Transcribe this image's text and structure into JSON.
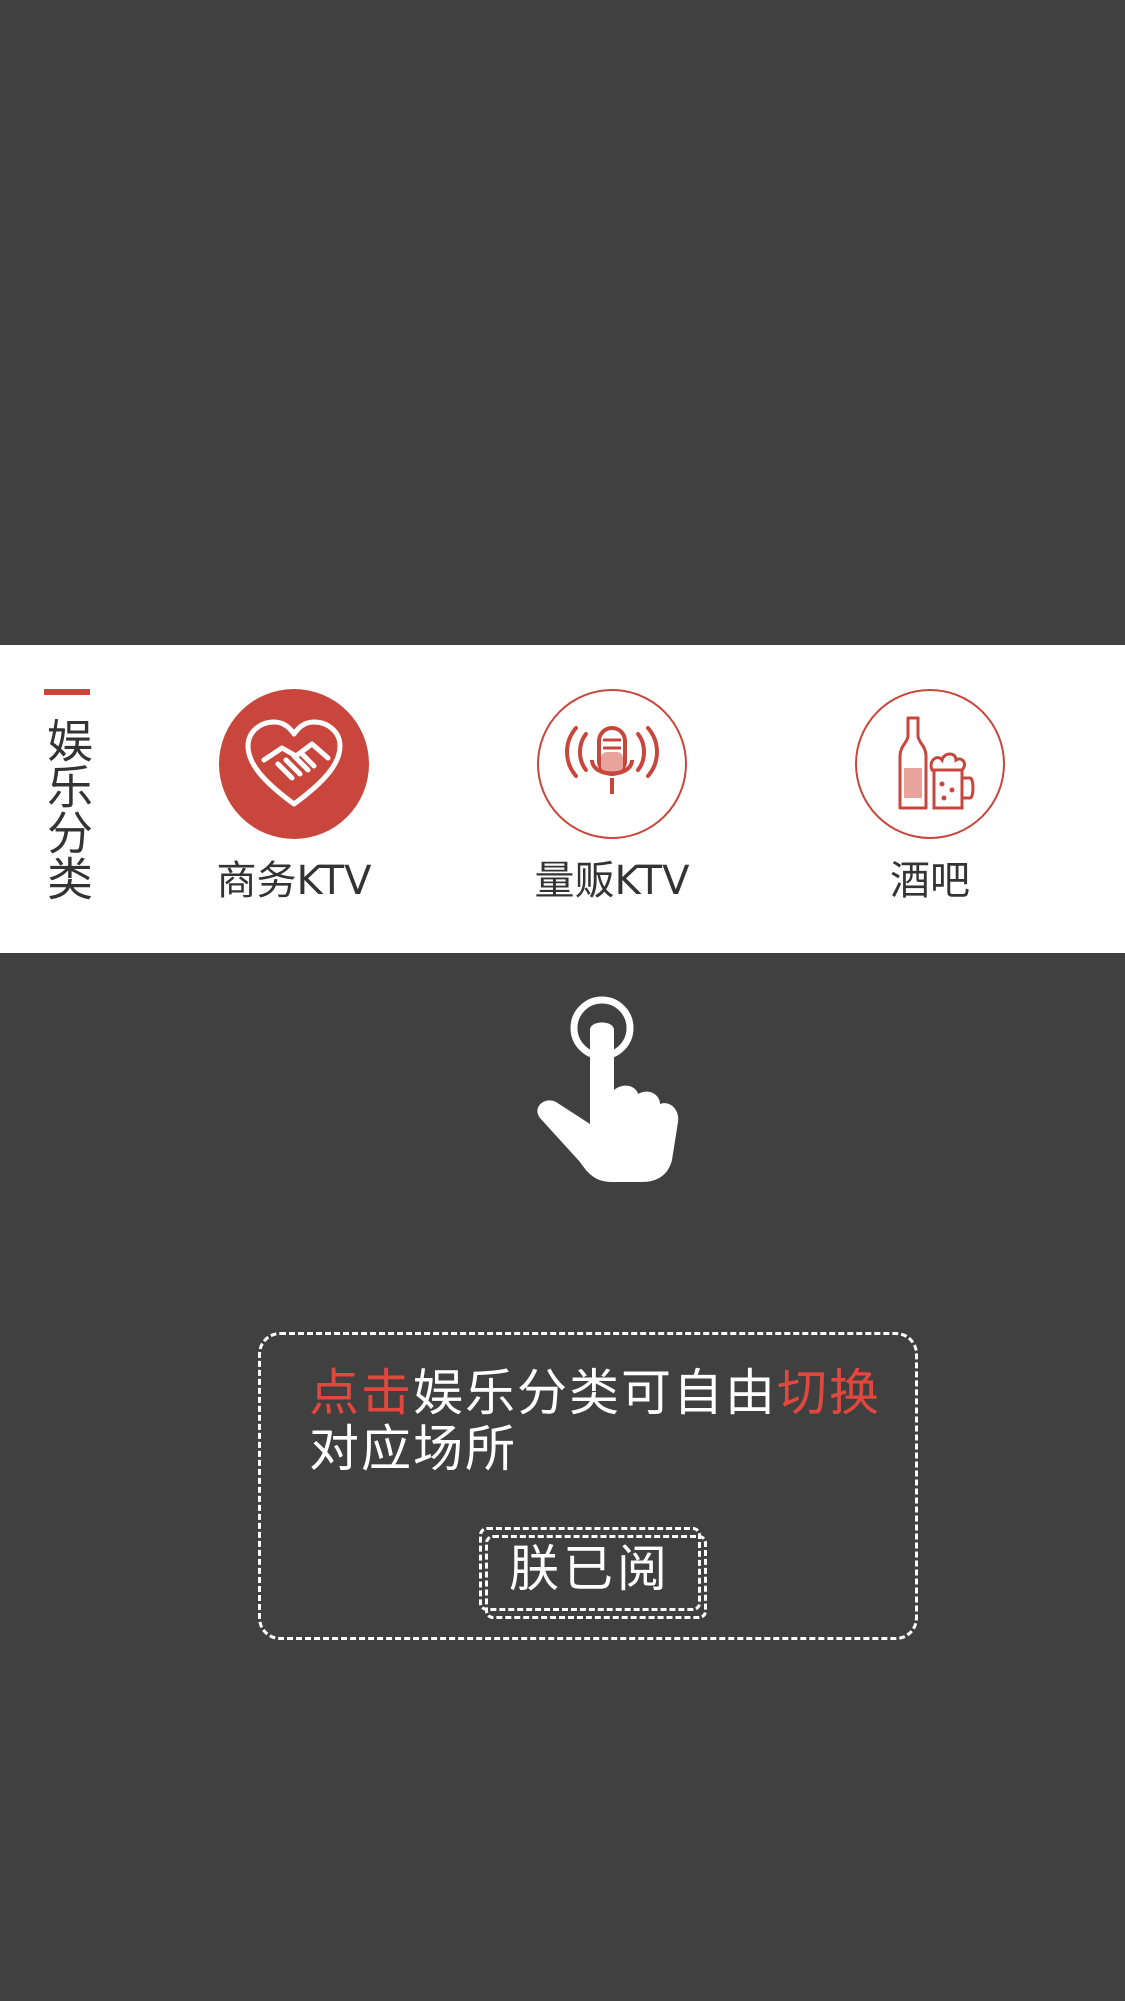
{
  "category_bar": {
    "heading": "娱乐分类",
    "items": [
      {
        "label": "商务KTV",
        "icon": "handshake-heart-icon",
        "active": true
      },
      {
        "label": "量贩KTV",
        "icon": "microphone-icon",
        "active": false
      },
      {
        "label": "酒吧",
        "icon": "wine-beer-icon",
        "active": false
      }
    ]
  },
  "hint_icon": "tap-hand-icon",
  "tip": {
    "highlight_1": "点击",
    "text_1": "娱乐分类可自由",
    "highlight_2": "切换",
    "text_2": "对应场所",
    "button_label": "朕已阅"
  },
  "colors": {
    "overlay": "#404040",
    "accent": "#c8463b",
    "highlight": "#e0483d",
    "text": "#333333"
  }
}
